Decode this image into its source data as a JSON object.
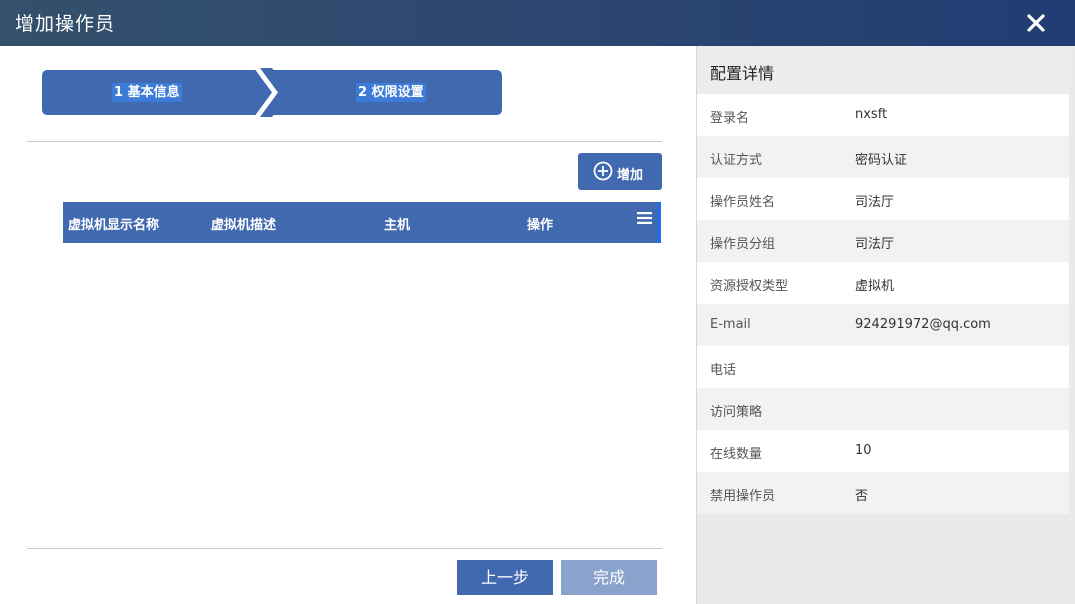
{
  "dialog": {
    "title": "增加操作员",
    "close_icon": "close-icon"
  },
  "steps": [
    {
      "label": "1 基本信息"
    },
    {
      "label": "2 权限设置"
    }
  ],
  "toolbar": {
    "add_label": "增加",
    "add_icon": "plus-circle-icon"
  },
  "table": {
    "columns": [
      "虚拟机显示名称",
      "虚拟机描述",
      "主机",
      "操作"
    ],
    "menu_icon": "hamburger-menu-icon",
    "rows": []
  },
  "footer": {
    "prev_label": "上一步",
    "done_label": "完成"
  },
  "details": {
    "title": "配置详情",
    "items": [
      {
        "key": "登录名",
        "value": "nxsft"
      },
      {
        "key": "认证方式",
        "value": "密码认证"
      },
      {
        "key": "操作员姓名",
        "value": "司法厅"
      },
      {
        "key": "操作员分组",
        "value": "司法厅"
      },
      {
        "key": "资源授权类型",
        "value": "虚拟机"
      },
      {
        "key": "E-mail",
        "value": "924291972@qq.com"
      },
      {
        "key": "电话",
        "value": ""
      },
      {
        "key": "访问策略",
        "value": ""
      },
      {
        "key": "在线数量",
        "value": "10"
      },
      {
        "key": "禁用操作员",
        "value": "否"
      }
    ]
  },
  "colors": {
    "primary": "#4169b0",
    "disabled": "#8aa3cc",
    "titlebar": "#2b4670"
  }
}
